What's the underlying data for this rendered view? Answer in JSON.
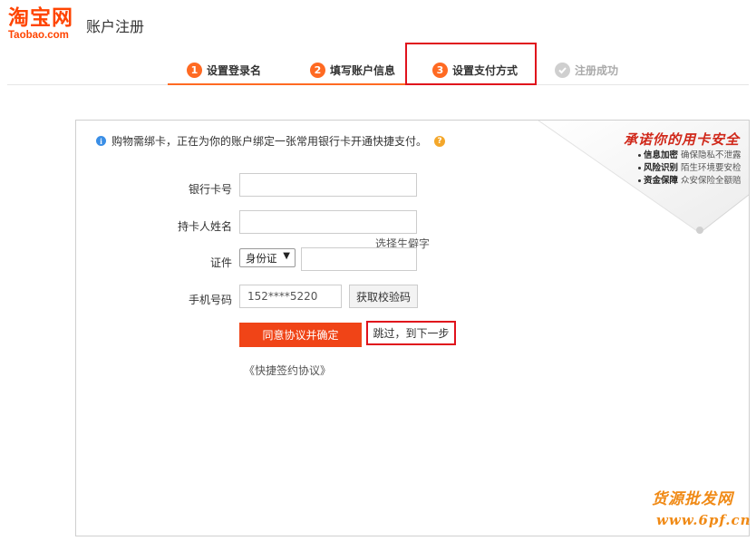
{
  "header": {
    "logo_cn": "淘宝网",
    "logo_en": "Taobao.com",
    "title": "账户注册"
  },
  "steps": [
    {
      "number": "1",
      "label": "设置登录名",
      "state": "complete"
    },
    {
      "number": "2",
      "label": "填写账户信息",
      "state": "complete"
    },
    {
      "number": "3",
      "label": "设置支付方式",
      "state": "current"
    },
    {
      "number": "",
      "label": "注册成功",
      "state": "pending"
    }
  ],
  "security": {
    "title": "承诺你的用卡安全",
    "items": [
      {
        "key": "信息加密",
        "desc": "确保隐私不泄露"
      },
      {
        "key": "风险识别",
        "desc": "陌生环境要安检"
      },
      {
        "key": "资金保障",
        "desc": "众安保险全额赔"
      }
    ]
  },
  "info": {
    "icon_char": "i",
    "text": "购物需绑卡，正在为你的账户绑定一张常用银行卡开通快捷支付。",
    "help_char": "?"
  },
  "form": {
    "card_number_label": "银行卡号",
    "card_number_value": "",
    "holder_name_label": "持卡人姓名",
    "holder_name_value": "",
    "rare_char_text": "选择生僻字",
    "id_label": "证件",
    "id_type_selected": "身份证",
    "id_number_value": "",
    "phone_label": "手机号码",
    "phone_value": "152****5220",
    "get_code_button": "获取校验码",
    "submit_button": "同意协议并确定",
    "skip_link": "跳过，到下一步",
    "agreement_link": "《快捷签约协议》"
  },
  "watermark": {
    "line1": "货源批发网",
    "line2": "www.6pf.cn"
  },
  "colors": {
    "brand": "#ff4400",
    "step_accent": "#ff6a22",
    "submit_button": "#f04417",
    "highlight_box": "#e0121c",
    "info_icon": "#3a8ee6",
    "help_icon": "#f4a72a"
  }
}
